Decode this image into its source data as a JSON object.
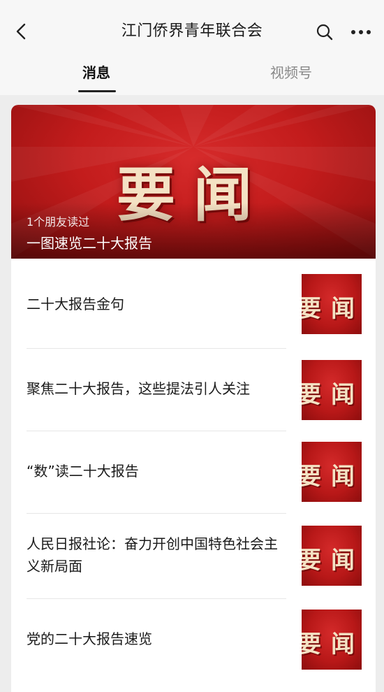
{
  "header": {
    "title": "江门侨界青年联合会"
  },
  "tabs": [
    {
      "label": "消息",
      "active": true
    },
    {
      "label": "视频号",
      "active": false
    }
  ],
  "hero": {
    "image_text": "要闻",
    "friends_read": "1个朋友读过",
    "title": "一图速览二十大报告"
  },
  "articles": [
    {
      "title": "二十大报告金句",
      "thumb_text": "要闻"
    },
    {
      "title": "聚焦二十大报告，这些提法引人关注",
      "thumb_text": "要闻"
    },
    {
      "title": "“数”读二十大报告",
      "thumb_text": "要闻"
    },
    {
      "title": "人民日报社论：奋力开创中国特色社会主义新局面",
      "thumb_text": "要闻"
    },
    {
      "title": "党的二十大报告速览",
      "thumb_text": "要闻"
    }
  ],
  "icons": {
    "back": "chevron-left-icon",
    "search": "search-icon",
    "more": "more-icon"
  },
  "colors": {
    "accent_red": "#c31c1c",
    "header_bg": "#f7f7f7",
    "page_bg": "#ededed"
  }
}
